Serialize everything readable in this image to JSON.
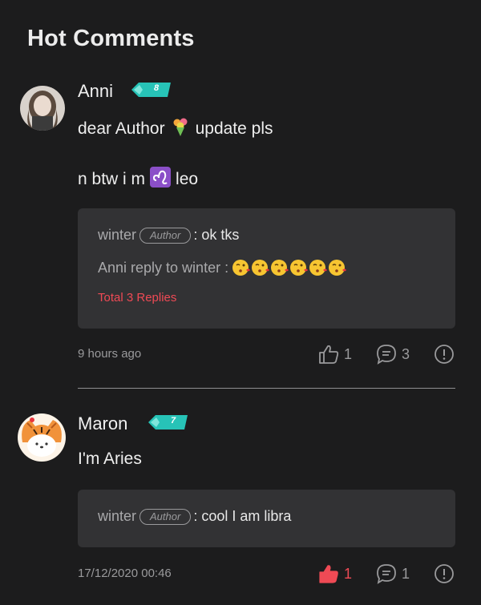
{
  "section_title": "Hot Comments",
  "colors": {
    "accent_red": "#ef4a55",
    "level_badge": "#27c3b7",
    "background": "#1c1c1d",
    "reply_box": "#323234"
  },
  "comments": [
    {
      "username": "Anni",
      "level": "8",
      "lines": [
        {
          "before": "dear Author",
          "emoji": "bouquet-emoji",
          "after": "update pls"
        },
        {
          "before": "n btw i m",
          "emoji": "leo-zodiac-emoji",
          "after": "leo"
        }
      ],
      "replies": [
        {
          "name": "winter",
          "badge": "Author",
          "text": ": ok tks"
        },
        {
          "name": "Anni reply to winter :",
          "emoji": "kissing-face-emoji",
          "emoji_count": 6
        }
      ],
      "total_replies": "Total 3 Replies",
      "timestamp": "9 hours ago",
      "likes": "1",
      "reply_count": "3",
      "liked": false
    },
    {
      "username": "Maron",
      "level": "7",
      "lines": [
        {
          "before": "I'm Aries"
        }
      ],
      "replies": [
        {
          "name": "winter",
          "badge": "Author",
          "text": ": cool I am libra"
        }
      ],
      "timestamp": "17/12/2020 00:46",
      "likes": "1",
      "reply_count": "1",
      "liked": true
    }
  ],
  "icons": {
    "like": "thumbs-up-icon",
    "reply": "comment-bubble-icon",
    "report": "report-exclamation-icon"
  }
}
